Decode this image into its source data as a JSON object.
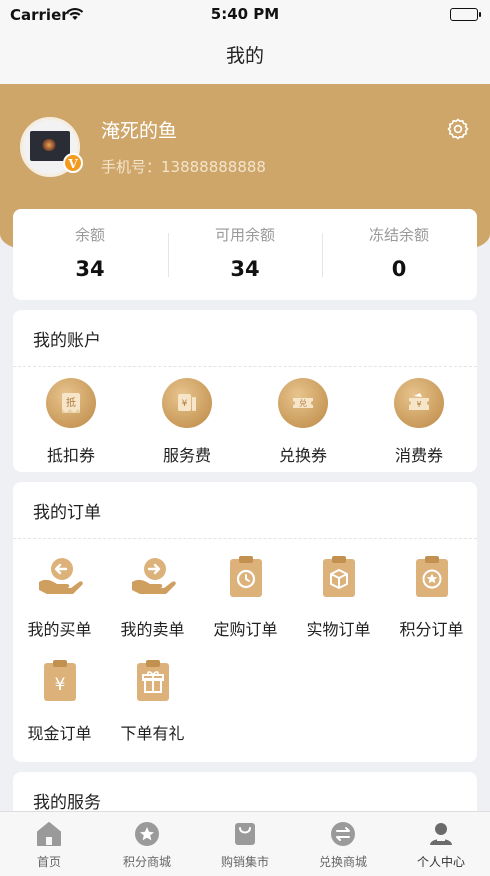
{
  "status_bar": {
    "carrier": "Carrier",
    "time": "5:40 PM"
  },
  "nav": {
    "title": "我的"
  },
  "profile": {
    "name": "淹死的鱼",
    "phone": "手机号：13888888888",
    "vip_badge": "V",
    "avatar_icon": "avatar-image",
    "settings_icon": "gear-icon"
  },
  "balance": {
    "items": [
      {
        "label": "余额",
        "value": "34"
      },
      {
        "label": "可用余额",
        "value": "34"
      },
      {
        "label": "冻结余额",
        "value": "0"
      }
    ]
  },
  "account": {
    "title": "我的账户",
    "items": [
      {
        "label": "抵扣券",
        "icon": "voucher-icon",
        "glyph": "抵"
      },
      {
        "label": "服务费",
        "icon": "service-fee-icon",
        "glyph": "¥"
      },
      {
        "label": "兑换券",
        "icon": "exchange-ticket-icon",
        "glyph": "兑"
      },
      {
        "label": "消费券",
        "icon": "consumer-coupon-icon",
        "glyph": "¥"
      }
    ]
  },
  "orders": {
    "title": "我的订单",
    "items": [
      {
        "label": "我的买单",
        "icon": "hand-arrow-left-icon"
      },
      {
        "label": "我的卖单",
        "icon": "hand-arrow-right-icon"
      },
      {
        "label": "定购订单",
        "icon": "clipboard-clock-icon"
      },
      {
        "label": "实物订单",
        "icon": "clipboard-box-icon"
      },
      {
        "label": "积分订单",
        "icon": "clipboard-star-icon"
      },
      {
        "label": "现金订单",
        "icon": "clipboard-yuan-icon",
        "glyph": "¥"
      },
      {
        "label": "下单有礼",
        "icon": "clipboard-gift-icon"
      }
    ]
  },
  "services": {
    "title": "我的服务"
  },
  "tab_bar": {
    "items": [
      {
        "label": "首页",
        "icon": "home-icon"
      },
      {
        "label": "积分商城",
        "icon": "star-icon"
      },
      {
        "label": "购销集市",
        "icon": "shopping-bag-icon"
      },
      {
        "label": "兑换商城",
        "icon": "exchange-icon"
      },
      {
        "label": "个人中心",
        "icon": "user-icon"
      }
    ],
    "active": "个人中心"
  },
  "colors": {
    "accent": "#cfa66a",
    "icon_gold": "#d4a66a",
    "tab_inactive": "#9a9a9a",
    "tab_active": "#6b6b6b"
  }
}
